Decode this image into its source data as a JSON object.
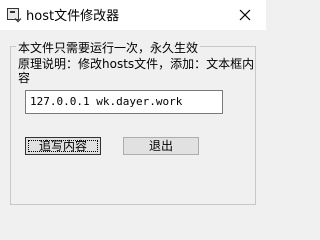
{
  "window": {
    "title": "host文件修改器"
  },
  "icons": {
    "app": "app-icon",
    "close": "close-icon"
  },
  "group": {
    "legend": "本文件只需要运行一次，永久生效",
    "description": "原理说明：修改hosts文件，添加：文本框内容"
  },
  "host_field": {
    "value": "127.0.0.1 wk.dayer.work"
  },
  "buttons": {
    "write_label": "追写内容",
    "exit_label": "退出"
  }
}
